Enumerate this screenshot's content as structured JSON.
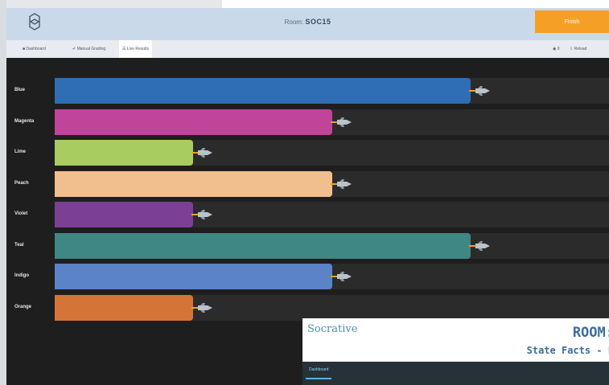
{
  "header": {
    "room_prefix": "Room:",
    "room_name": "SOC15",
    "finish_label": "Finish"
  },
  "subnav": {
    "items": [
      {
        "label": "■ Dashboard"
      },
      {
        "label": "✔ Manual Grading"
      },
      {
        "label": "☰ Live Results"
      }
    ],
    "right_items": [
      {
        "label": "◉ 0"
      },
      {
        "label": "⇩ Reload"
      }
    ]
  },
  "race": {
    "teams": [
      {
        "name": "Blue",
        "color": "#2f6db5",
        "progress": 0.75
      },
      {
        "name": "Magenta",
        "color": "#c0449a",
        "progress": 0.5
      },
      {
        "name": "Lime",
        "color": "#a8cc60",
        "progress": 0.25
      },
      {
        "name": "Peach",
        "color": "#f1be8d",
        "progress": 0.5
      },
      {
        "name": "Violet",
        "color": "#7b3f96",
        "progress": 0.25
      },
      {
        "name": "Teal",
        "color": "#3f8784",
        "progress": 0.75
      },
      {
        "name": "Indigo",
        "color": "#5b83c8",
        "progress": 0.5
      },
      {
        "name": "Orange",
        "color": "#d47436",
        "progress": 0.25
      }
    ]
  },
  "overlay": {
    "logo": "Socrative",
    "room_title": "ROOM:",
    "subtitle": "State Facts - F",
    "tab_label": "Dashboard"
  }
}
